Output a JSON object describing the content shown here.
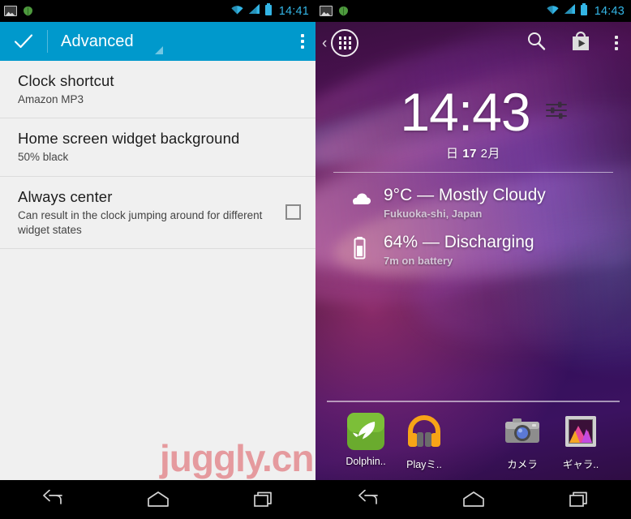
{
  "left_phone": {
    "statusbar": {
      "time": "14:41",
      "icons": [
        "screenshot-icon",
        "leaf-icon",
        "wifi-icon",
        "signal-icon",
        "battery-icon"
      ]
    },
    "actionbar": {
      "title": "Advanced",
      "done_icon": "checkmark-icon",
      "spinner_icon": "spinner-triangle-icon",
      "overflow_icon": "overflow-menu-icon",
      "background_color": "#0099cc"
    },
    "settings": [
      {
        "title": "Clock shortcut",
        "subtitle": "Amazon MP3",
        "has_checkbox": false
      },
      {
        "title": "Home screen widget background",
        "subtitle": "50% black",
        "has_checkbox": false
      },
      {
        "title": "Always center",
        "subtitle": "Can result in the clock jumping around for different widget states",
        "has_checkbox": true,
        "checked": false
      }
    ]
  },
  "right_phone": {
    "statusbar": {
      "time": "14:43",
      "icons": [
        "screenshot-icon",
        "leaf-icon",
        "wifi-icon",
        "signal-icon",
        "battery-icon"
      ]
    },
    "home_actions": {
      "drawer_icon": "app-drawer-icon",
      "back_chevron": "‹",
      "search_icon": "search-icon",
      "play_store_icon": "play-store-icon",
      "overflow_icon": "overflow-menu-icon"
    },
    "widget": {
      "time": "14:43",
      "date_weekday": "日",
      "date_day": "17",
      "date_month": "2月",
      "settings_icon": "sliders-icon",
      "weather": {
        "icon": "cloud-icon",
        "main": "9°C — Mostly Cloudy",
        "sub": "Fukuoka-shi, Japan"
      },
      "battery": {
        "icon": "battery-icon",
        "main": "64% — Discharging",
        "sub": "7m on battery"
      }
    },
    "dock": [
      {
        "label": "Dolphin..",
        "icon": "dolphin-browser-icon"
      },
      {
        "label": "Playミ..",
        "icon": "play-music-icon"
      },
      {
        "label": "カメラ",
        "icon": "camera-icon"
      },
      {
        "label": "ギャラ..",
        "icon": "gallery-icon"
      }
    ]
  },
  "watermark": {
    "text": "juggly.cn",
    "color": "#d6242e"
  },
  "navbar": {
    "back": "back-icon",
    "home": "home-icon",
    "recents": "recents-icon"
  }
}
